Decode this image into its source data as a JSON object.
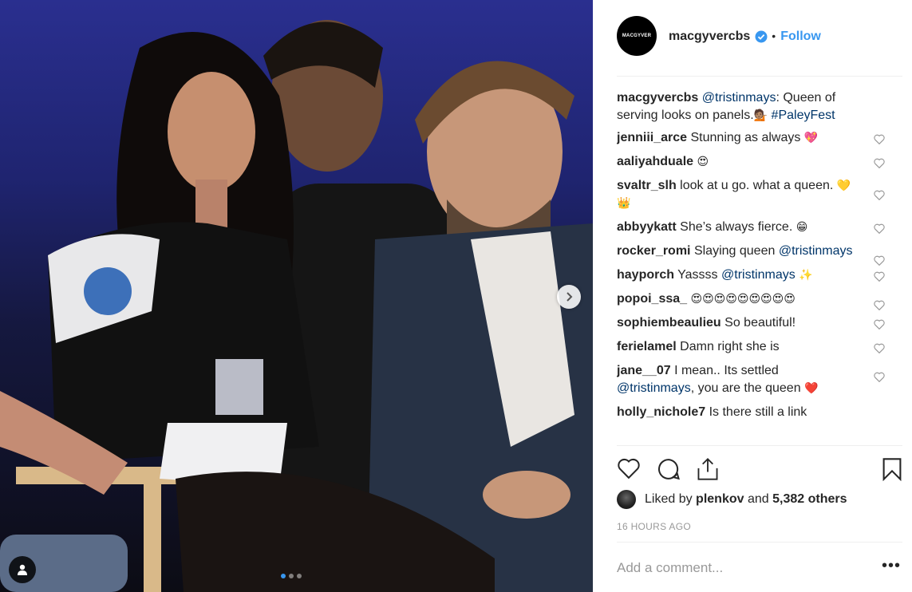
{
  "post": {
    "username": "macgyvercbs",
    "avatar_text": "MACGYVER",
    "follow_label": "Follow",
    "separator": "•",
    "carousel": {
      "total": 3,
      "active": 1
    }
  },
  "caption": {
    "username": "macgyvercbs",
    "mention": "@tristinmays",
    "text": ": Queen of serving looks on panels.",
    "emoji": "💁🏽",
    "hashtag": "#PaleyFest"
  },
  "comments": [
    {
      "username": "jenniii_arce",
      "text": "Stunning as always",
      "emoji": "💖"
    },
    {
      "username": "aaliyahduale",
      "text": "",
      "emoji": "😍"
    },
    {
      "username": "svaltr_slh",
      "text": "look at u go. what a queen.",
      "emoji": "💛👑"
    },
    {
      "username": "abbyykatt",
      "text": "She’s always fierce.",
      "emoji": "😁"
    },
    {
      "username": "rocker_romi",
      "text": "Slaying queen",
      "mention": "@tristinmays"
    },
    {
      "username": "hayporch",
      "text": "Yassss",
      "mention": "@tristinmays",
      "emoji": "✨"
    },
    {
      "username": "popoi_ssa_",
      "text": "",
      "emoji": "😍😍😍😍😍😍😍😍😍"
    },
    {
      "username": "sophiembeaulieu",
      "text": "So beautiful!"
    },
    {
      "username": "ferielamel",
      "text": "Damn right she is"
    },
    {
      "username": "jane__07",
      "text": "I mean.. Its settled",
      "mention": "@tristinmays",
      "text2": ", you are the queen",
      "emoji": "❤️"
    },
    {
      "username": "holly_nichole7",
      "text": "Is there still a link"
    }
  ],
  "likes": {
    "prefix": "Liked by",
    "user": "plenkov",
    "and": "and",
    "others": "5,382 others"
  },
  "timestamp": "16 HOURS AGO",
  "add_comment_placeholder": "Add a comment...",
  "more_label": "•••",
  "colors": {
    "link": "#3897f0",
    "mention": "#003569",
    "verified": "#3897f0",
    "heart_red": "#ed4956"
  }
}
